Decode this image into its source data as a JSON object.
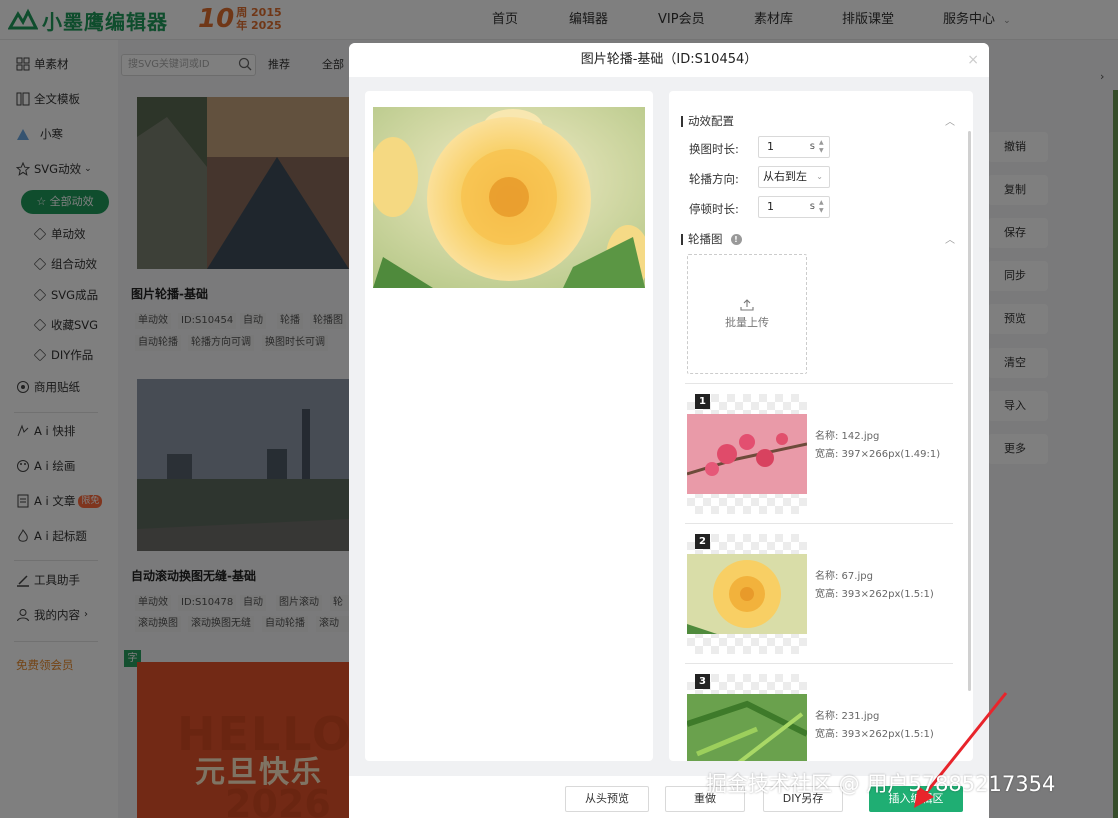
{
  "header": {
    "brand": "小墨鹰编辑器",
    "anniv_num": "10",
    "anniv_line1": "周 2015",
    "anniv_line2": "年 2025",
    "nav": [
      "首页",
      "编辑器",
      "VIP会员",
      "素材库",
      "排版课堂",
      "服务中心"
    ]
  },
  "sidebar": {
    "items": [
      {
        "label": "单素材"
      },
      {
        "label": "全文模板"
      },
      {
        "label": "小寒"
      },
      {
        "label": "SVG动效"
      },
      {
        "label": "全部动效"
      },
      {
        "label": "单动效"
      },
      {
        "label": "组合动效"
      },
      {
        "label": "SVG成品"
      },
      {
        "label": "收藏SVG"
      },
      {
        "label": "DIY作品"
      },
      {
        "label": "商用贴纸"
      },
      {
        "label": "A i 快排"
      },
      {
        "label": "A i 绘画"
      },
      {
        "label": "A i 文章"
      },
      {
        "label": "A i 起标题"
      },
      {
        "label": "工具助手"
      },
      {
        "label": "我的内容"
      },
      {
        "label": "免费领会员"
      }
    ],
    "new_badge": "限免"
  },
  "content": {
    "search_placeholder": "搜SVG关键词或ID",
    "filters": [
      "推荐",
      "全部"
    ],
    "card1": {
      "title": "图片轮播-基础",
      "tags": [
        "单动效",
        "ID:S10454",
        "自动",
        "轮播",
        "轮播图",
        "自动轮播",
        "轮播方向可调",
        "换图时长可调"
      ]
    },
    "card2": {
      "title": "自动滚动换图无缝-基础",
      "tags": [
        "单动效",
        "ID:S10478",
        "自动",
        "图片滚动",
        "轮播",
        "滚动换图",
        "滚动换图无缝",
        "自动轮播",
        "滚动方"
      ]
    },
    "card3": {
      "hello": "HELLO",
      "text": "元旦快乐",
      "year": "2026",
      "badge": "字"
    }
  },
  "right_tools": [
    "撤销",
    "复制",
    "保存",
    "同步",
    "预览",
    "清空",
    "导入",
    "更多"
  ],
  "modal": {
    "title": "图片轮播-基础（ID:S10454）",
    "close": "×",
    "config": {
      "section1": "动效配置",
      "switch_label": "换图时长:",
      "switch_value": "1",
      "switch_unit": "s",
      "direction_label": "轮播方向:",
      "direction_value": "从右到左",
      "pause_label": "停顿时长:",
      "pause_value": "1",
      "pause_unit": "s",
      "section2": "轮播图",
      "upload_label": "批量上传"
    },
    "images": [
      {
        "num": "1",
        "name": "名称: 142.jpg",
        "size": "宽高: 397×266px(1.49:1)"
      },
      {
        "num": "2",
        "name": "名称: 67.jpg",
        "size": "宽高: 393×262px(1.5:1)"
      },
      {
        "num": "3",
        "name": "名称: 231.jpg",
        "size": "宽高: 393×262px(1.5:1)"
      }
    ],
    "footer": {
      "replay": "从头预览",
      "redo": "重做",
      "save_as": "DIY另存",
      "insert": "插入编辑区"
    }
  },
  "watermark": "掘金技术社区 @ 用户57885217354",
  "colors": {
    "brand_green": "#1f9a5b",
    "primary_button": "#1fae73",
    "arrow_red": "#e8242b",
    "anniv_orange": "#e06f2f"
  }
}
